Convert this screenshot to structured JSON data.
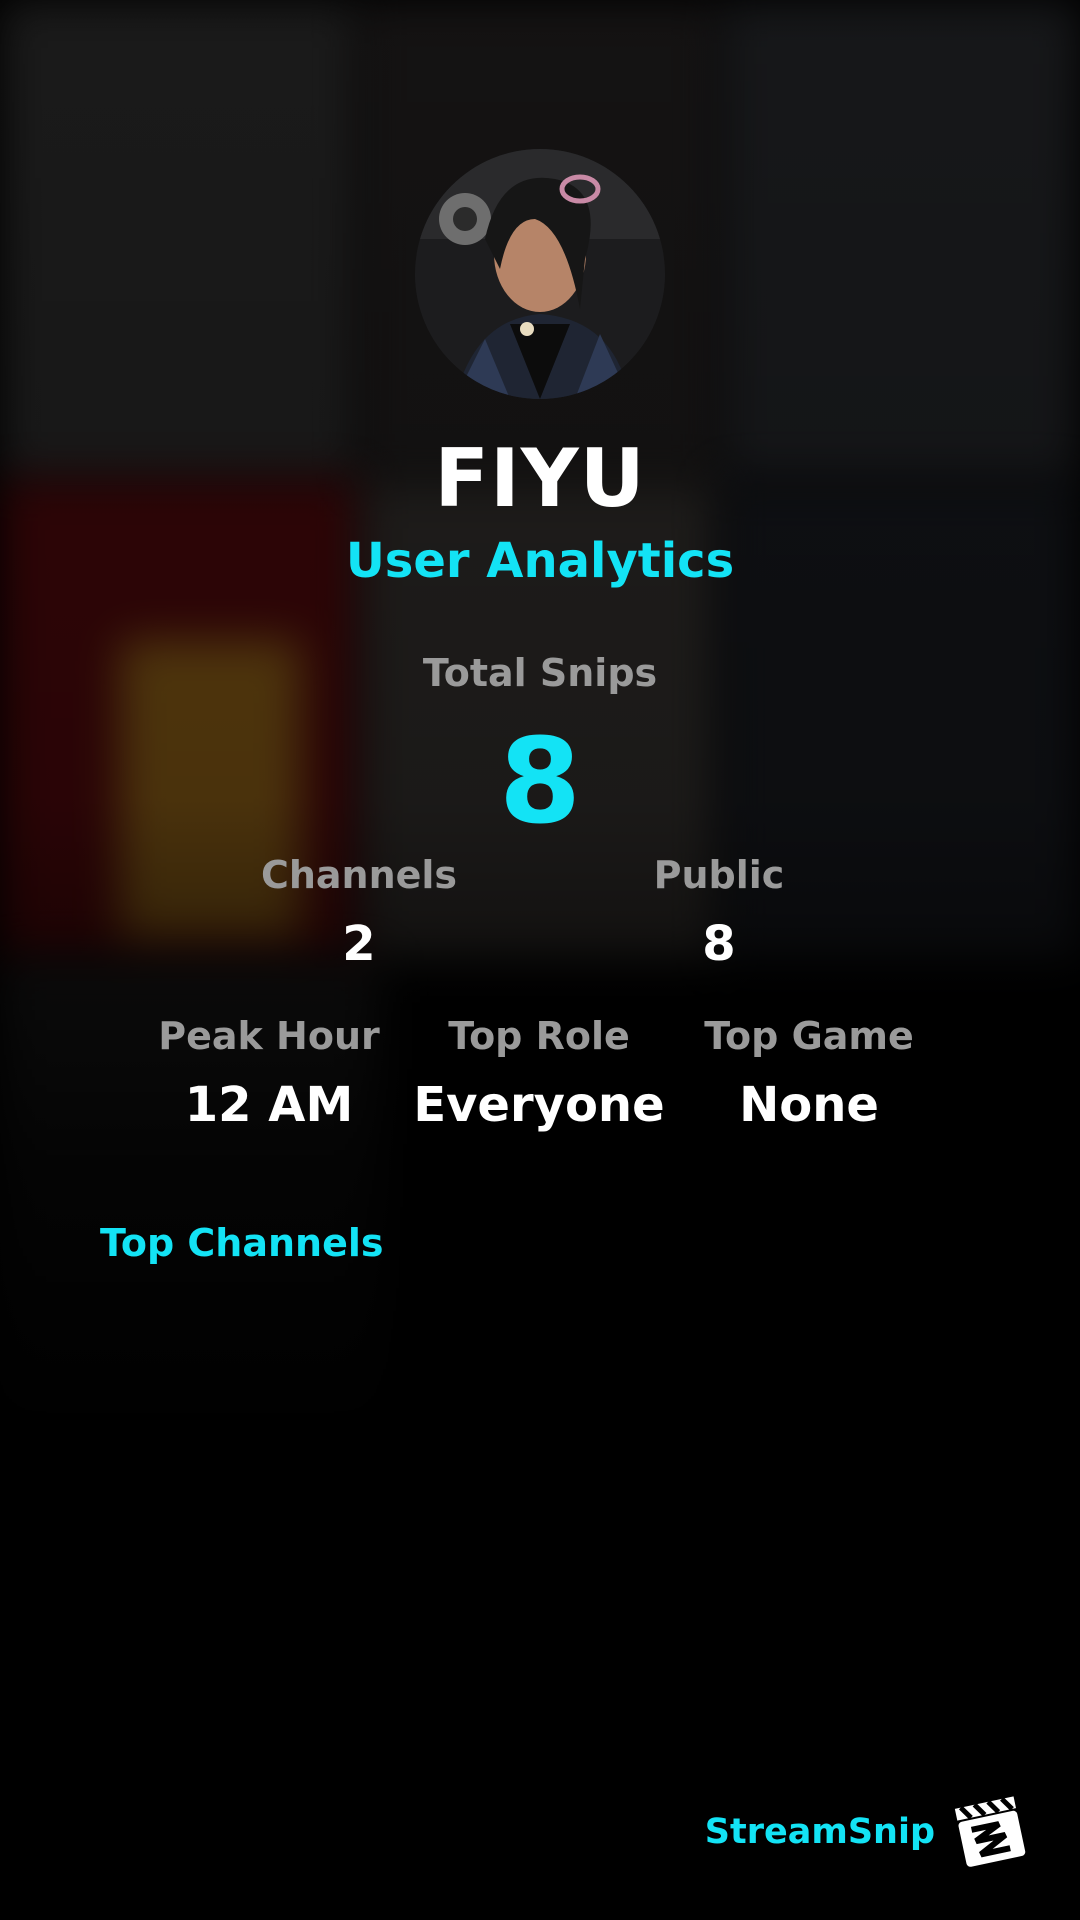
{
  "profile": {
    "username": "FIYU",
    "subtitle": "User Analytics"
  },
  "summary": {
    "total_label": "Total Snips",
    "total_value": "8"
  },
  "stats_row1": [
    {
      "label": "Channels",
      "value": "2"
    },
    {
      "label": "Public",
      "value": "8"
    }
  ],
  "stats_row2": [
    {
      "label": "Peak Hour",
      "value": "12 AM"
    },
    {
      "label": "Top Role",
      "value": "Everyone"
    },
    {
      "label": "Top Game",
      "value": "None"
    }
  ],
  "top_channels": {
    "title": "Top Channels"
  },
  "brand": {
    "name": "StreamSnip",
    "logo_icon": "clapperboard-icon"
  },
  "colors": {
    "accent": "#13e3f5",
    "label": "#9a9a9a",
    "value": "#ffffff",
    "background": "#000000"
  }
}
